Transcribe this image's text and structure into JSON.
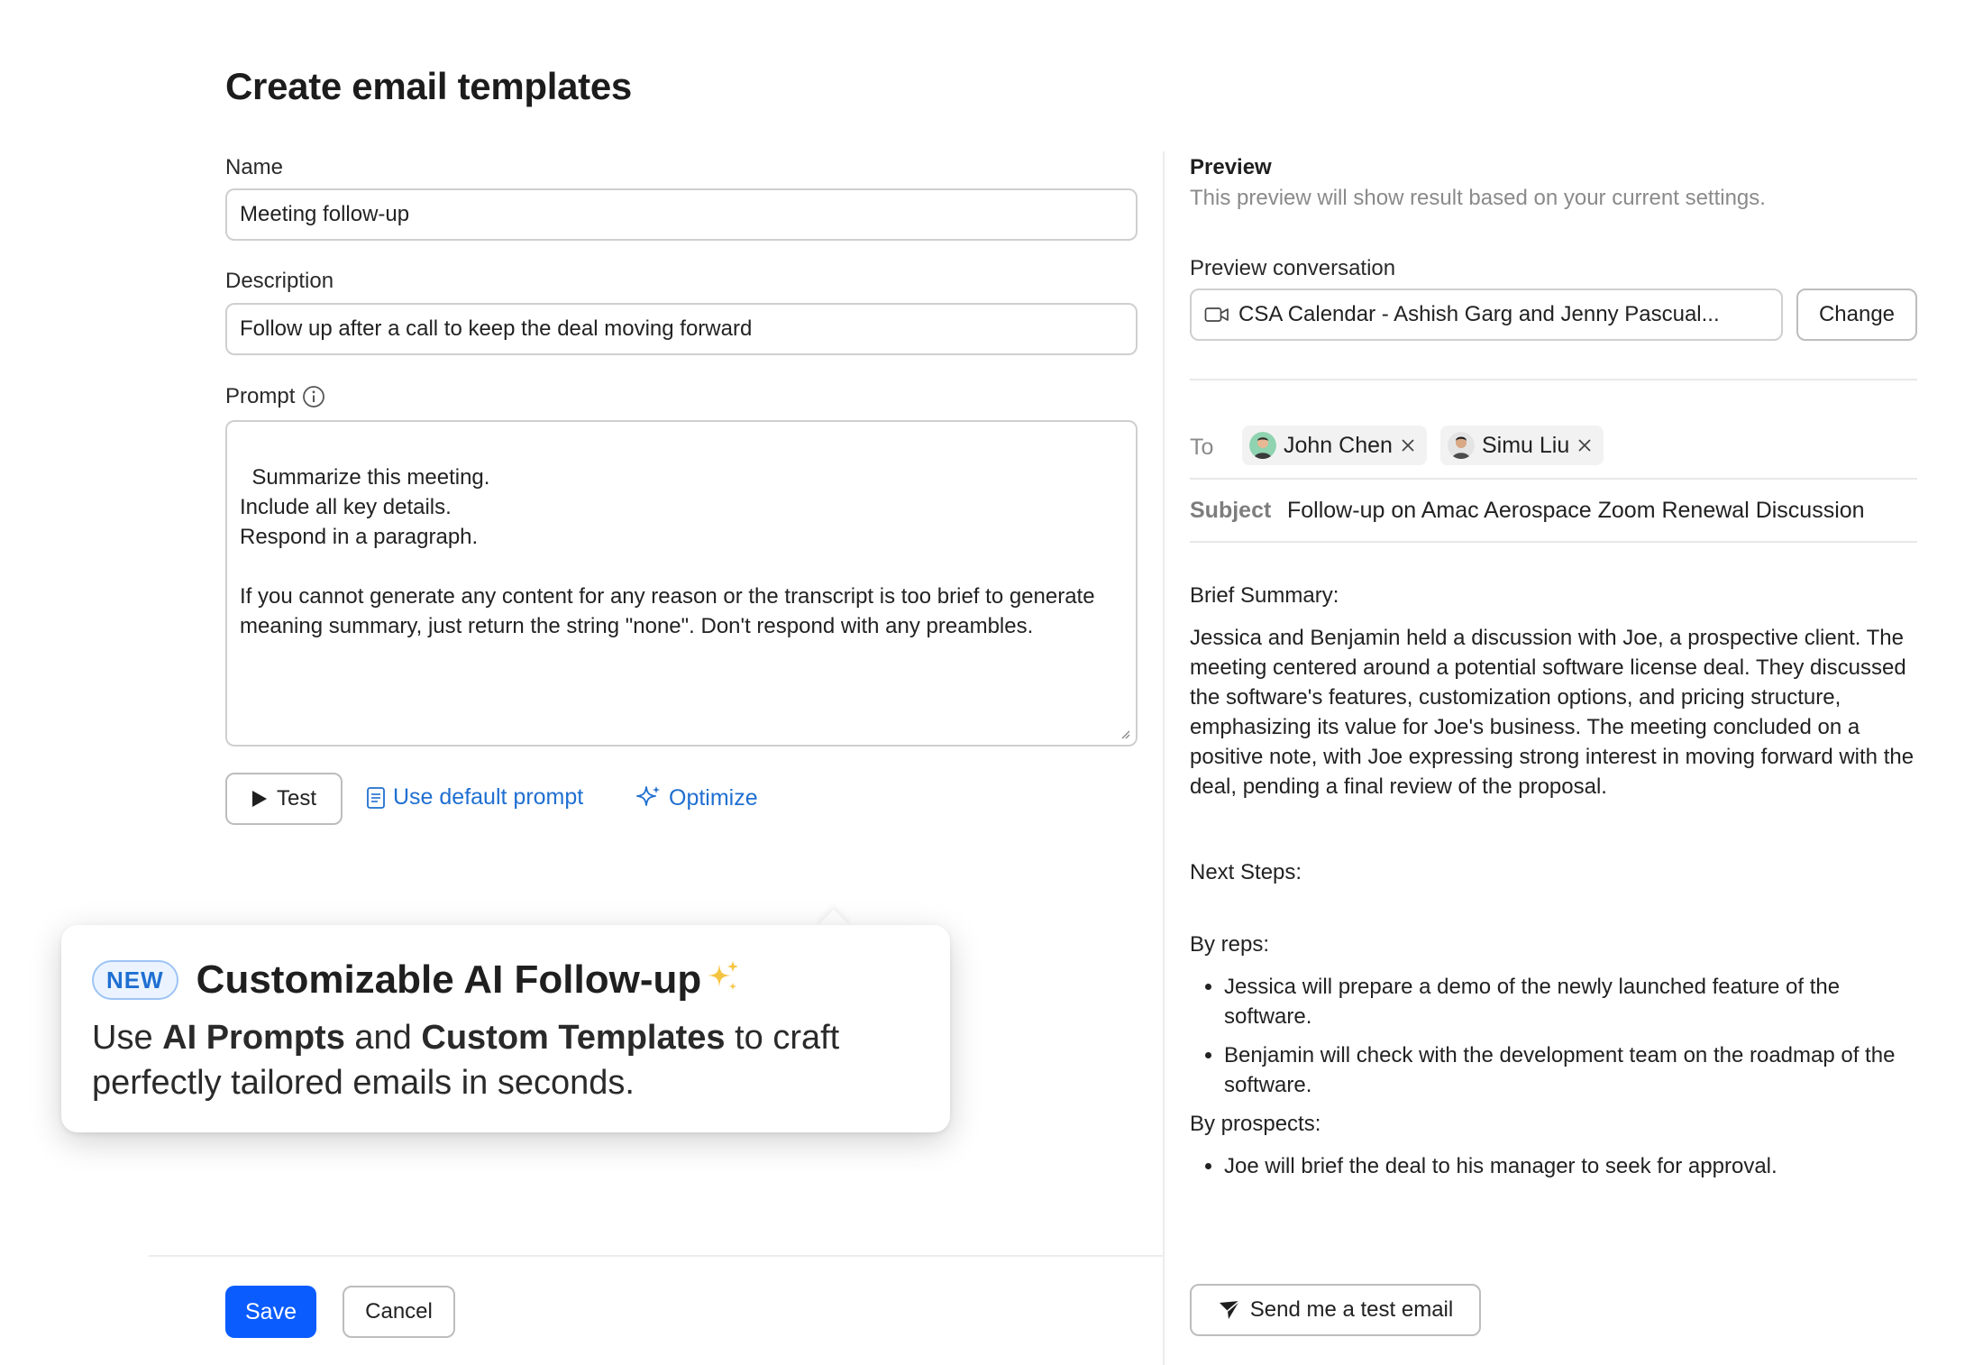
{
  "page_title": "Create email templates",
  "form": {
    "name_label": "Name",
    "name_value": "Meeting follow-up",
    "description_label": "Description",
    "description_value": "Follow up after a call to keep the deal moving forward",
    "prompt_label": "Prompt",
    "prompt_value": "Summarize this meeting.\nInclude all key details.\nRespond in a paragraph.\n\nIf you cannot generate any content for any reason or the transcript is too brief to generate meaning summary, just return the string \"none\". Don't respond with any preambles.",
    "test_label": "Test",
    "default_prompt_label": "Use default prompt",
    "optimize_label": "Optimize"
  },
  "popover": {
    "badge": "NEW",
    "title": "Customizable AI Follow-up",
    "text_1": "Use ",
    "text_bold_1": "AI Prompts",
    "text_2": " and ",
    "text_bold_2": "Custom Templates",
    "text_3": " to craft perfectly tailored emails in seconds."
  },
  "footer": {
    "save_label": "Save",
    "cancel_label": "Cancel"
  },
  "preview": {
    "title": "Preview",
    "subtitle": "This preview will show result based on your current settings.",
    "conversation_label": "Preview conversation",
    "conversation_value": "CSA Calendar - Ashish Garg and Jenny Pascual...",
    "change_label": "Change",
    "to_label": "To",
    "recipients": [
      "John Chen",
      "Simu Liu"
    ],
    "subject_label": "Subject",
    "subject_value": "Follow-up on Amac Aerospace Zoom Renewal Discussion",
    "brief_summary_heading": "Brief Summary:",
    "brief_summary": "Jessica and Benjamin held a discussion with Joe, a prospective client. The meeting centered around a potential software license deal. They discussed the software's features, customization options, and pricing structure, emphasizing its value for Joe's business. The meeting concluded on a positive note, with Joe expressing strong interest in moving forward with the deal, pending a final review of the proposal.",
    "next_steps_heading": "Next Steps:",
    "by_reps_heading": "By reps:",
    "by_reps": [
      "Jessica will prepare a demo of the newly launched feature of the software.",
      "Benjamin will check with the development team on the roadmap of the software."
    ],
    "by_prospects_heading": "By prospects:",
    "by_prospects": [
      "Joe will brief the deal to his manager to seek for approval."
    ],
    "send_test_label": "Send me a test email"
  },
  "colors": {
    "accent": "#0b5cff",
    "link": "#1f6fd1",
    "new_badge_bg": "#eaf3ff",
    "sparkle": "#f5c542"
  },
  "icons": [
    "info-icon",
    "play-icon",
    "document-icon",
    "sparkle-icon",
    "video-camera-icon",
    "close-icon",
    "send-icon"
  ]
}
